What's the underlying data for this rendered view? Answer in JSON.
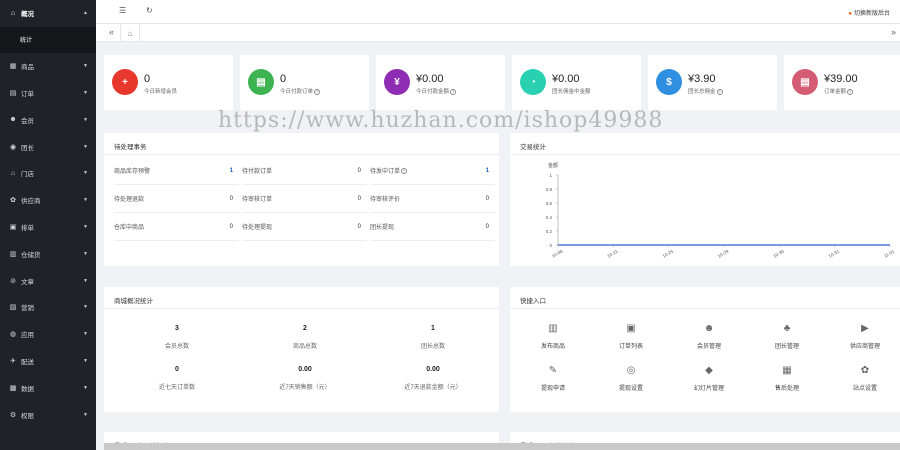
{
  "sidebar": {
    "items": [
      {
        "icon": "home-icon",
        "glyph": "⌂",
        "label": "概况",
        "caret": "▲"
      },
      {
        "icon": "goods-icon",
        "glyph": "▦",
        "label": "商品",
        "caret": "▼"
      },
      {
        "icon": "order-icon",
        "glyph": "▤",
        "label": "订单",
        "caret": "▼"
      },
      {
        "icon": "member-icon",
        "glyph": "☻",
        "label": "会员",
        "caret": "▼"
      },
      {
        "icon": "leader-icon",
        "glyph": "◉",
        "label": "团长",
        "caret": "▼"
      },
      {
        "icon": "store-icon",
        "glyph": "⌂",
        "label": "门店",
        "caret": "▼"
      },
      {
        "icon": "supplier-icon",
        "glyph": "✿",
        "label": "供应商",
        "caret": "▼"
      },
      {
        "icon": "delivery-icon",
        "glyph": "▣",
        "label": "排单",
        "caret": "▼"
      },
      {
        "icon": "sorting-icon",
        "glyph": "▥",
        "label": "仓储货",
        "caret": "▼"
      },
      {
        "icon": "article-icon",
        "glyph": "⊘",
        "label": "文章",
        "caret": "▼"
      },
      {
        "icon": "marketing-icon",
        "glyph": "▨",
        "label": "营销",
        "caret": "▼"
      },
      {
        "icon": "apps-icon",
        "glyph": "◍",
        "label": "应用",
        "caret": "▼"
      },
      {
        "icon": "shipping-icon",
        "glyph": "✈",
        "label": "配送",
        "caret": "▼"
      },
      {
        "icon": "data-icon",
        "glyph": "▩",
        "label": "数据",
        "caret": "▼"
      },
      {
        "icon": "permission-icon",
        "glyph": "⚙",
        "label": "权限",
        "caret": "▼"
      }
    ],
    "sub_item": "统计"
  },
  "topbar": {
    "menu_glyph": "☰",
    "refresh_glyph": "↻",
    "switch_label": "切换新版后台"
  },
  "tabbar": {
    "left_arrows": "«",
    "home_glyph": "⌂",
    "right_arrows": "»"
  },
  "stats": [
    {
      "value": "0",
      "label": "今日新增会员",
      "help": "",
      "color": "#e8372c",
      "glyph": "+"
    },
    {
      "value": "0",
      "label": "今日付款订单",
      "help": "?",
      "color": "#3db352",
      "glyph": "▤"
    },
    {
      "value": "¥0.00",
      "label": "今日付款金额",
      "help": "?",
      "color": "#8e2db3",
      "glyph": "¥"
    },
    {
      "value": "¥0.00",
      "label": "团长佣金中金额",
      "help": "",
      "color": "#2ad0b2",
      "glyph": "◔"
    },
    {
      "value": "¥3.90",
      "label": "团长总佣金",
      "help": "?",
      "color": "#2f8fe0",
      "glyph": "$"
    },
    {
      "value": "¥39.00",
      "label": "订单金额",
      "help": "?",
      "color": "#d45c73",
      "glyph": "▤"
    }
  ],
  "watermark": "https://www.huzhan.com/ishop49988",
  "todo": {
    "title": "待处理事务",
    "cells": [
      {
        "label": "商品库存预警",
        "help": "",
        "value": "1"
      },
      {
        "label": "待付款订单",
        "help": "",
        "value": "0"
      },
      {
        "label": "待发中订单",
        "help": "?",
        "value": "1"
      },
      {
        "label": "待处理退款",
        "help": "",
        "value": "0"
      },
      {
        "label": "待审核订单",
        "help": "",
        "value": "0"
      },
      {
        "label": "待审核评价",
        "help": "",
        "value": "0"
      },
      {
        "label": "仓库中商品",
        "help": "",
        "value": "0"
      },
      {
        "label": "待处理提现",
        "help": "",
        "value": "0"
      },
      {
        "label": "团长提现",
        "help": "",
        "value": "0"
      }
    ]
  },
  "chart_data": {
    "type": "line",
    "title": "交易统计",
    "ylabel": "金额",
    "x": [
      "10-08",
      "10-21",
      "10-25",
      "10-29",
      "10-30",
      "10-31",
      "11-01"
    ],
    "y_ticks": [
      "1",
      "0.8",
      "0.6",
      "0.4",
      "0.2",
      "0"
    ],
    "ylim": [
      0,
      1
    ],
    "series": [
      {
        "values": [
          0,
          0,
          0,
          0,
          0,
          0,
          0
        ],
        "color": "#2f5fc4"
      }
    ]
  },
  "operations": {
    "title": "商城概况统计",
    "stats": [
      {
        "value": "3",
        "label": "会员总数"
      },
      {
        "value": "2",
        "label": "商品总数"
      },
      {
        "value": "1",
        "label": "团长总数"
      },
      {
        "value": "0",
        "label": "近七天订单数"
      },
      {
        "value": "0.00",
        "label": "近7天销售额（元）"
      },
      {
        "value": "0.00",
        "label": "近7天退款金额（元）"
      }
    ]
  },
  "quick": {
    "title": "快捷入口",
    "items": [
      {
        "icon": "publish-goods-icon",
        "glyph": "▥",
        "label": "发布商品"
      },
      {
        "icon": "order-list-icon",
        "glyph": "▣",
        "label": "订单列表"
      },
      {
        "icon": "member-manage-icon",
        "glyph": "☻",
        "label": "会员管理"
      },
      {
        "icon": "leader-manage-icon",
        "glyph": "♣",
        "label": "团长管理"
      },
      {
        "icon": "supplier-manage-icon",
        "glyph": "▶",
        "label": "供应商管理"
      },
      {
        "icon": "withdraw-apply-icon",
        "glyph": "✎",
        "label": "提现申请"
      },
      {
        "icon": "withdraw-settings-icon",
        "glyph": "◎",
        "label": "提现设置"
      },
      {
        "icon": "slides-manage-icon",
        "glyph": "◆",
        "label": "幻灯片管理"
      },
      {
        "icon": "after-sale-icon",
        "glyph": "▦",
        "label": "售后处理"
      },
      {
        "icon": "site-settings-icon",
        "glyph": "✿",
        "label": "站点设置"
      }
    ]
  },
  "bottom_panels": [
    {
      "title": "最近7天会员增长情况"
    },
    {
      "title": "最近7天团长增长情况"
    }
  ]
}
